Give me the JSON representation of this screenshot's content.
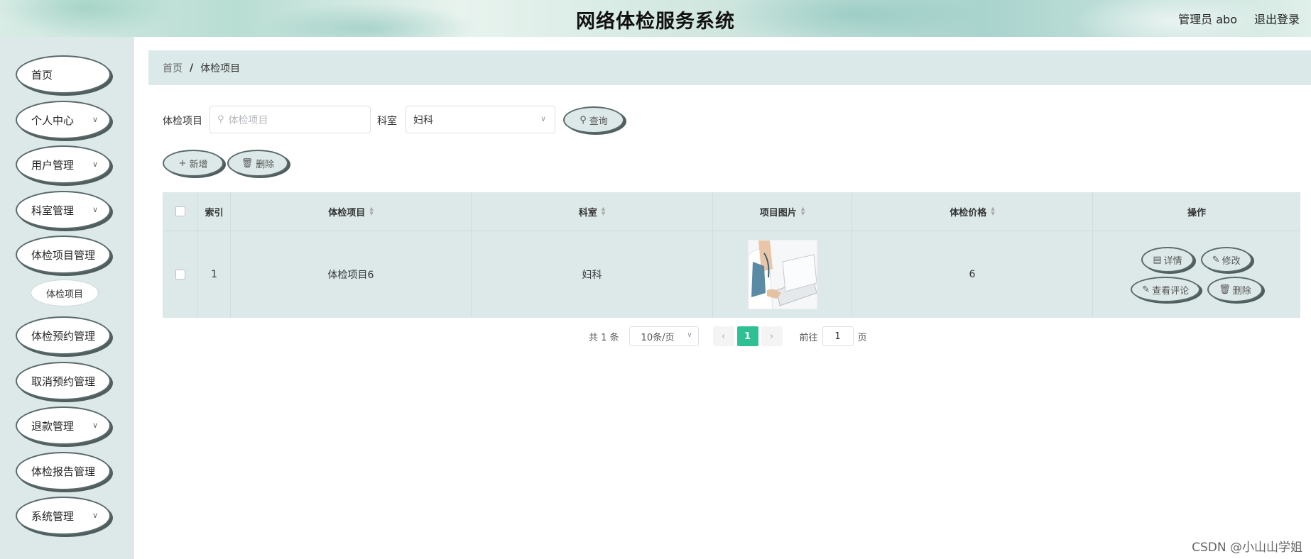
{
  "header": {
    "title": "网络体检服务系统",
    "user": "管理员 abo",
    "logout": "退出登录"
  },
  "sidebar": {
    "items": [
      {
        "label": "首页",
        "has_arrow": false
      },
      {
        "label": "个人中心",
        "has_arrow": true
      },
      {
        "label": "用户管理",
        "has_arrow": true
      },
      {
        "label": "科室管理",
        "has_arrow": true
      },
      {
        "label": "体检项目管理",
        "has_arrow": false
      },
      {
        "label": "体检预约管理",
        "has_arrow": false
      },
      {
        "label": "取消预约管理",
        "has_arrow": false
      },
      {
        "label": "退款管理",
        "has_arrow": true
      },
      {
        "label": "体检报告管理",
        "has_arrow": false
      },
      {
        "label": "系统管理",
        "has_arrow": true
      }
    ],
    "sub_item": "体检项目"
  },
  "breadcrumb": {
    "home": "首页",
    "separator": "/",
    "current": "体检项目"
  },
  "search": {
    "item_label": "体检项目",
    "item_placeholder": "体检项目",
    "dept_label": "科室",
    "dept_value": "妇科",
    "query_button": "查询"
  },
  "toolbar": {
    "add": "新增",
    "delete": "删除"
  },
  "table": {
    "headers": {
      "index": "索引",
      "item": "体检项目",
      "dept": "科室",
      "image": "项目图片",
      "price": "体检价格",
      "actions": "操作"
    },
    "rows": [
      {
        "index": "1",
        "item": "体检项目6",
        "dept": "妇科",
        "image": "doctor-with-laptop",
        "price": "6"
      }
    ],
    "row_actions": {
      "detail": "详情",
      "edit": "修改",
      "comments": "查看评论",
      "delete": "删除"
    }
  },
  "pagination": {
    "total": "共 1 条",
    "page_size": "10条/页",
    "current_page": "1",
    "goto_label": "前往",
    "goto_value": "1",
    "page_suffix": "页"
  },
  "watermark": "CSDN @小山山学姐",
  "colors": {
    "sidebar_bg": "#dde9e9",
    "accent": "#2fbf94",
    "button_border": "#5a6b6b"
  }
}
